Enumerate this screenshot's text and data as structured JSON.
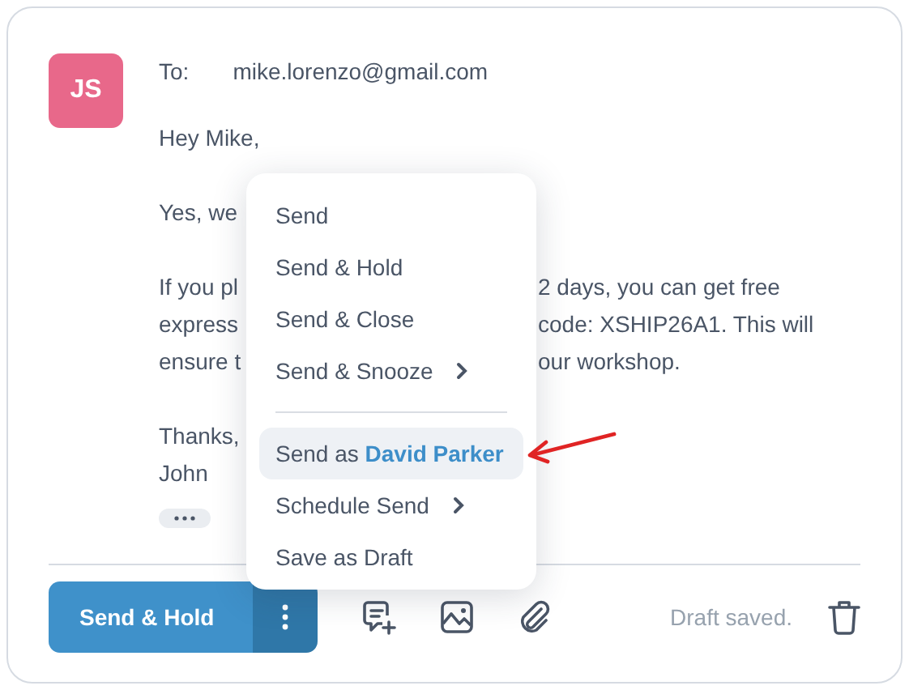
{
  "avatar": {
    "initials": "JS",
    "color": "#e8688a"
  },
  "to": {
    "label": "To:",
    "address": "mike.lorenzo@gmail.com"
  },
  "body": {
    "lines": [
      {
        "kind": "text",
        "parts": [
          "Hey Mike,"
        ]
      },
      {
        "kind": "blank"
      },
      {
        "kind": "text",
        "parts": [
          "Yes, we"
        ]
      },
      {
        "kind": "blank"
      },
      {
        "kind": "text",
        "parts": [
          "If you pl",
          "2 days, you can get free"
        ]
      },
      {
        "kind": "text",
        "parts": [
          "express",
          "code: XSHIP26A1. This will"
        ]
      },
      {
        "kind": "text",
        "parts": [
          "ensure t",
          "our workshop."
        ]
      },
      {
        "kind": "blank"
      },
      {
        "kind": "text",
        "parts": [
          "Thanks,"
        ]
      },
      {
        "kind": "text",
        "parts": [
          "John"
        ]
      }
    ]
  },
  "menu": {
    "items": [
      {
        "kind": "item",
        "label": "Send",
        "highlighted": false,
        "submenu": false
      },
      {
        "kind": "item",
        "label": "Send & Hold",
        "highlighted": false,
        "submenu": false
      },
      {
        "kind": "item",
        "label": "Send & Close",
        "highlighted": false,
        "submenu": false
      },
      {
        "kind": "item",
        "label": "Send & Snooze",
        "highlighted": false,
        "submenu": true
      },
      {
        "kind": "divider"
      },
      {
        "kind": "item",
        "label": "Send as **David Parker**",
        "highlighted": true,
        "submenu": false
      },
      {
        "kind": "item",
        "label": "Schedule Send",
        "highlighted": false,
        "submenu": true
      },
      {
        "kind": "item",
        "label": "Save as Draft",
        "highlighted": false,
        "submenu": false
      }
    ]
  },
  "footer": {
    "send_button": "Send & Hold",
    "status": "Draft saved."
  }
}
